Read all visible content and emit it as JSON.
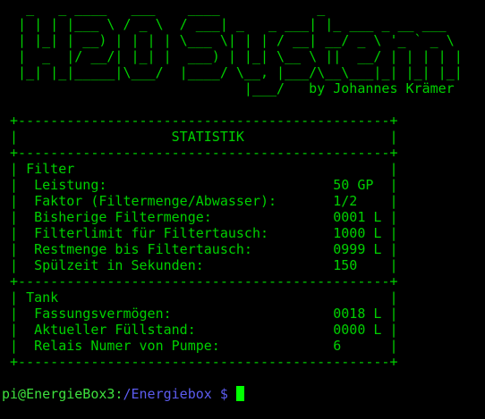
{
  "banner": {
    "art_lines": [
      "   _   _ ____   ___    ____            _",
      "  | | | |___ \\ / _ \\  / ___| _   _ ___| |_ ___ _ __ ___",
      "  | |_| | __) | | | | \\___ \\| | | / __| __/ _ \\ '_ ` _ \\",
      "  |  _  |/ __/| |_| |  ___) | |_| \\__ \\ ||  __/ | | | | |",
      "  |_| |_|_____|\\___/  |____/ \\__, |___/\\__\\___|_| |_| |_|",
      "                              |___/"
    ],
    "author": "by Johannes Krämer"
  },
  "stats": {
    "title": "STATISTIK",
    "sections": [
      {
        "name": "Filter",
        "rows": [
          {
            "label": "Leistung:",
            "value": "50 GP"
          },
          {
            "label": "Faktor (Filtermenge/Abwasser):",
            "value": "1/2"
          },
          {
            "label": "Bisherige Filtermenge:",
            "value": "0001 L"
          },
          {
            "label": "Filterlimit für Filtertausch:",
            "value": "1000 L"
          },
          {
            "label": "Restmenge bis Filtertausch:",
            "value": "0999 L"
          },
          {
            "label": "Spülzeit in Sekunden:",
            "value": "150"
          }
        ]
      },
      {
        "name": "Tank",
        "rows": [
          {
            "label": "Fassungsvermögen:",
            "value": "0018 L"
          },
          {
            "label": "Aktueller Füllstand:",
            "value": "0000 L"
          },
          {
            "label": "Relais Numer von Pumpe:",
            "value": "6"
          }
        ]
      }
    ]
  },
  "prompt": {
    "user_host": "pi@EnergieBox3:",
    "path": "/Energiebox $"
  },
  "colors": {
    "text": "#00d000",
    "prompt_user": "#3ee03e",
    "prompt_path": "#5c5cf0",
    "cursor": "#00ff00"
  }
}
